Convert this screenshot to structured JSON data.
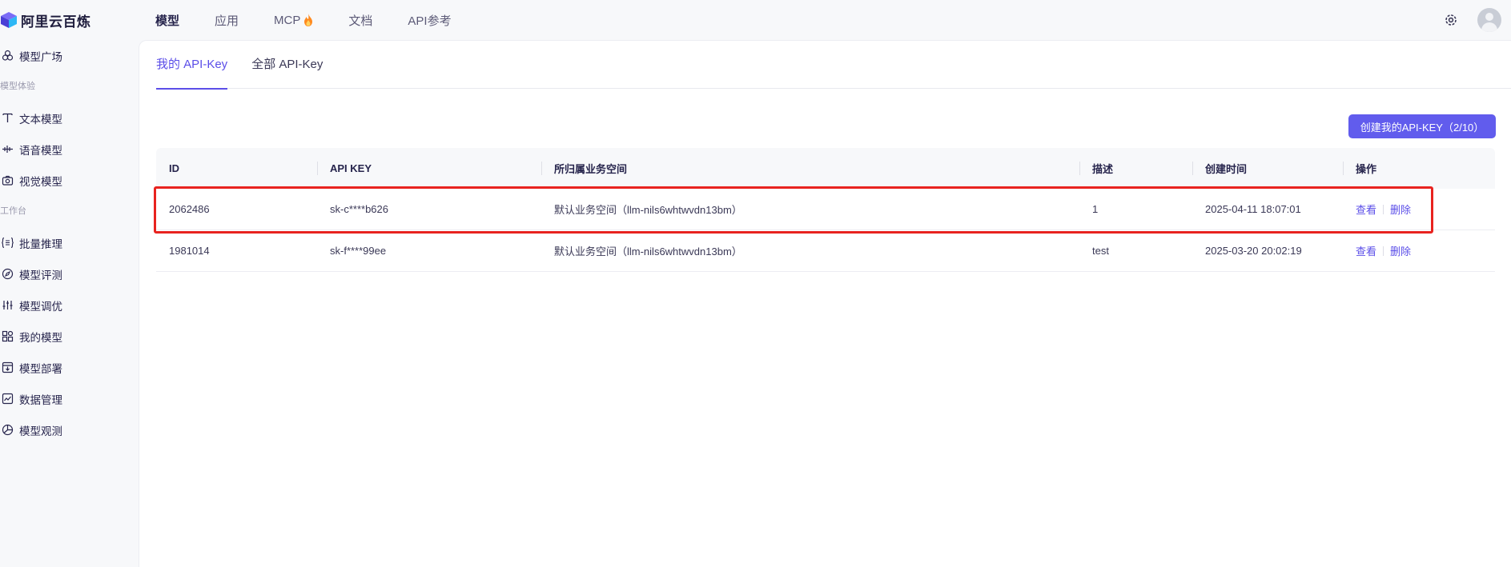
{
  "app": {
    "name": "阿里云百炼"
  },
  "top_nav": [
    {
      "label": "模型",
      "active": true
    },
    {
      "label": "应用",
      "active": false
    },
    {
      "label": "MCP",
      "active": false
    },
    {
      "label": "文档",
      "active": false
    },
    {
      "label": "API参考",
      "active": false
    }
  ],
  "sidebar": {
    "top_item": {
      "label": "模型广场",
      "icon": "model-square-icon"
    },
    "section_experience": "模型体验",
    "experience_items": [
      {
        "label": "文本模型",
        "icon": "text-icon"
      },
      {
        "label": "语音模型",
        "icon": "audio-wave-icon"
      },
      {
        "label": "视觉模型",
        "icon": "camera-icon"
      }
    ],
    "section_workbench": "工作台",
    "workbench_items": [
      {
        "label": "批量推理",
        "icon": "batch-icon"
      },
      {
        "label": "模型评测",
        "icon": "compass-icon"
      },
      {
        "label": "模型调优",
        "icon": "sliders-icon"
      },
      {
        "label": "我的模型",
        "icon": "grid-icon"
      },
      {
        "label": "模型部署",
        "icon": "deploy-icon"
      },
      {
        "label": "数据管理",
        "icon": "chart-line-icon"
      },
      {
        "label": "模型观测",
        "icon": "pie-icon"
      }
    ]
  },
  "tabs": [
    {
      "label": "我的 API-Key",
      "active": true
    },
    {
      "label": "全部 API-Key",
      "active": false
    }
  ],
  "create_button": "创建我的API-KEY（2/10）",
  "table": {
    "headers": [
      "ID",
      "API KEY",
      "所归属业务空间",
      "描述",
      "创建时间",
      "操作"
    ],
    "rows": [
      {
        "id": "2062486",
        "key": "sk-c****b626",
        "workspace": "默认业务空间（llm-nils6whtwvdn13bm）",
        "desc": "1",
        "created": "2025-04-11 18:07:01",
        "view": "查看",
        "delete": "删除"
      },
      {
        "id": "1981014",
        "key": "sk-f****99ee",
        "workspace": "默认业务空间（llm-nils6whtwvdn13bm）",
        "desc": "test",
        "created": "2025-03-20 20:02:19",
        "view": "查看",
        "delete": "删除"
      }
    ]
  },
  "colors": {
    "accent": "#5b4ee8",
    "button": "#615ced",
    "highlight": "#e8231f"
  }
}
